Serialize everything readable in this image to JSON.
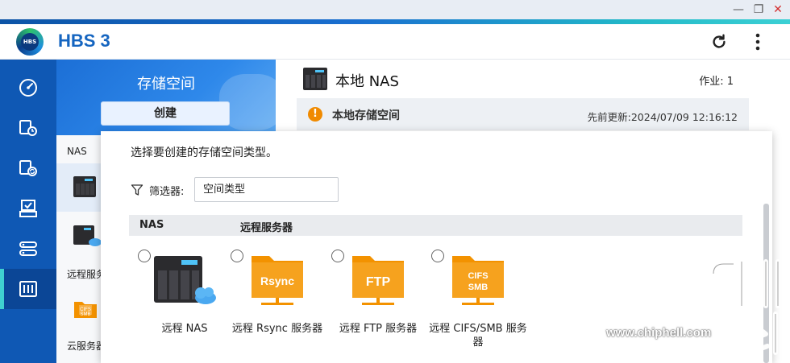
{
  "window": {
    "minimize": "—",
    "restore": "❐",
    "close": "✕"
  },
  "header": {
    "logo_text": "HBS",
    "title": "HBS 3",
    "refresh_icon": "refresh-icon",
    "more_icon": "more-vertical-icon"
  },
  "nav": {
    "items": [
      {
        "icon": "dashboard-icon"
      },
      {
        "icon": "backup-icon"
      },
      {
        "icon": "sync-icon"
      },
      {
        "icon": "restore-icon"
      },
      {
        "icon": "services-icon"
      },
      {
        "icon": "storage-icon",
        "active": true
      }
    ]
  },
  "storage_panel": {
    "title": "存储空间",
    "create_label": "创建",
    "section_nas": "NAS",
    "remote_label": "远程服务",
    "cloud_label": "云服务器"
  },
  "main": {
    "title": "本地 NAS",
    "jobs": "作业: 1",
    "local_storage": "本地存储空间",
    "updated": "先前更新:2024/07/09 12:16:12"
  },
  "dialog": {
    "prompt": "选择要创建的存储空间类型。",
    "filter_label": "筛选器:",
    "filter_value": "空间类型",
    "categories": [
      "NAS",
      "远程服务器"
    ],
    "options": [
      {
        "label": "远程 NAS",
        "badge": ""
      },
      {
        "label": "远程 Rsync 服务器",
        "badge": "Rsync"
      },
      {
        "label": "远程 FTP 服务器",
        "badge": "FTP"
      },
      {
        "label": "远程 CIFS/SMB 服务器",
        "badge_line1": "CIFS",
        "badge_line2": "SMB"
      }
    ]
  },
  "watermark": {
    "url": "www.chiphell.com"
  },
  "colors": {
    "brand_blue": "#1565c0",
    "nav_blue": "#0f58b4",
    "folder_orange": "#f39200",
    "warning": "#f08a00"
  }
}
